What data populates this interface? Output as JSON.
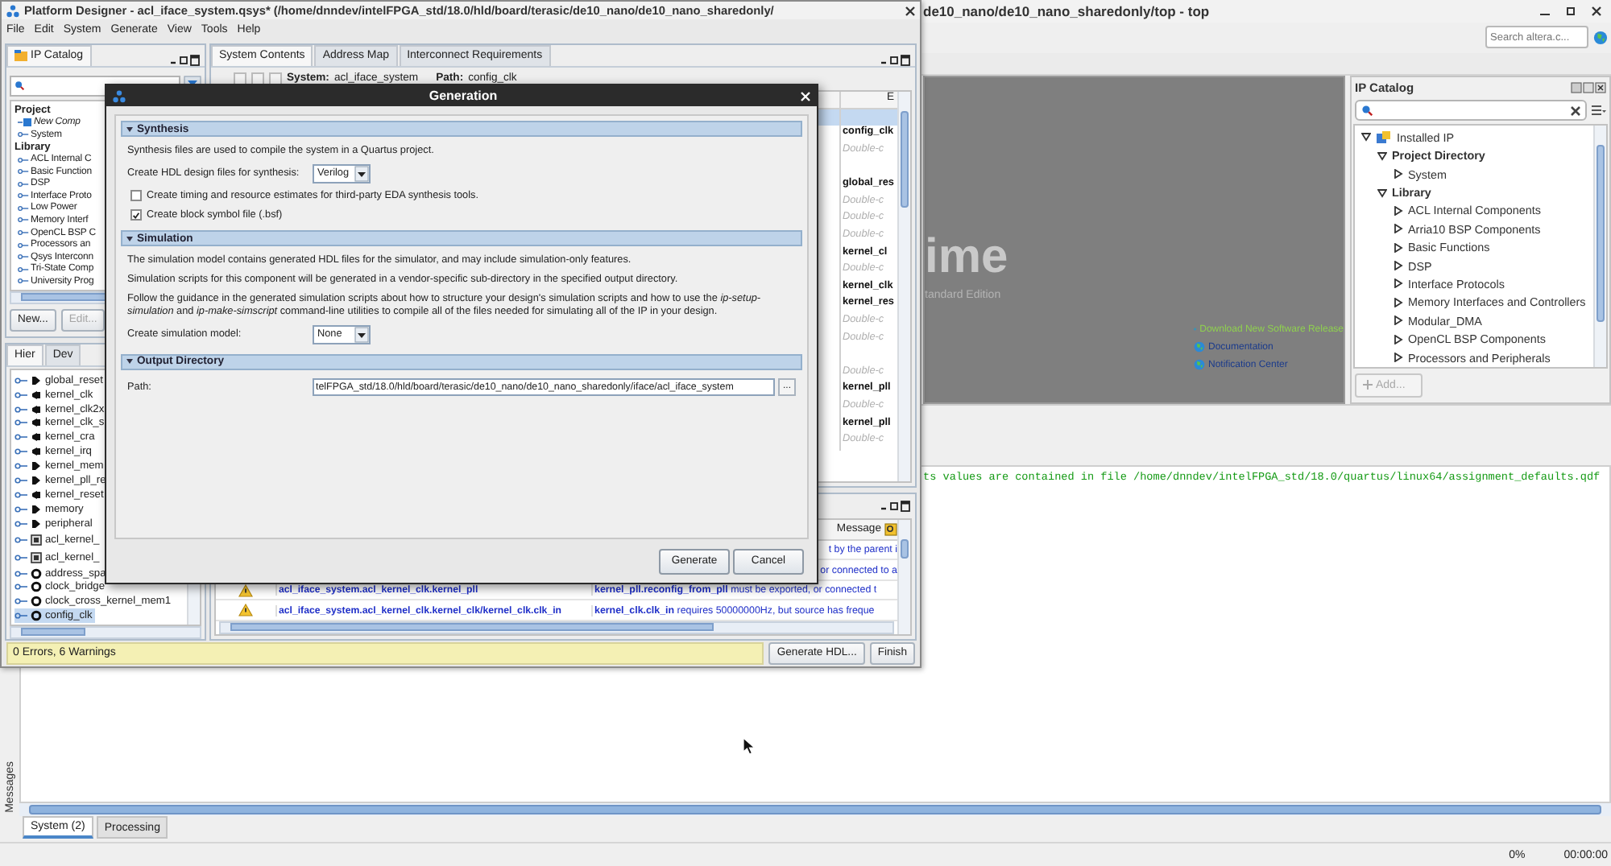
{
  "quartus": {
    "title": "de10_nano/de10_nano_sharedonly/top - top",
    "search": {
      "placeholder": "Search altera.c..."
    },
    "home": {
      "logo_text": "ime",
      "edition": "tandard Edition",
      "links": [
        {
          "label": "Download New Software Release",
          "kind": "highlight"
        },
        {
          "label": "Documentation",
          "kind": "normal"
        },
        {
          "label": "Notification Center",
          "kind": "normal"
        }
      ]
    },
    "ip_catalog": {
      "title": "IP Catalog",
      "tree": [
        {
          "label": "Installed IP",
          "kind": "root",
          "expanded": true,
          "children": [
            {
              "label": "Project Directory",
              "kind": "group",
              "expanded": true,
              "children": [
                {
                  "label": "System",
                  "kind": "item",
                  "expanded": false
                }
              ]
            },
            {
              "label": "Library",
              "kind": "group",
              "expanded": true,
              "children": [
                {
                  "label": "ACL Internal Components",
                  "kind": "item",
                  "expanded": false
                },
                {
                  "label": "Arria10 BSP Components",
                  "kind": "item",
                  "expanded": false
                },
                {
                  "label": "Basic Functions",
                  "kind": "item",
                  "expanded": false
                },
                {
                  "label": "DSP",
                  "kind": "item",
                  "expanded": false
                },
                {
                  "label": "Interface Protocols",
                  "kind": "item",
                  "expanded": false
                },
                {
                  "label": "Memory Interfaces and Controllers",
                  "kind": "item",
                  "expanded": false
                },
                {
                  "label": "Modular_DMA",
                  "kind": "item",
                  "expanded": false
                },
                {
                  "label": "OpenCL BSP Components",
                  "kind": "item",
                  "expanded": false
                },
                {
                  "label": "Processors and Peripherals",
                  "kind": "item",
                  "expanded": false
                }
              ]
            }
          ]
        }
      ],
      "add_button": {
        "label": "Add...",
        "disabled": true
      }
    },
    "messages": {
      "lines": [
        "ts values are contained in file /home/dnndev/intelFPGA_std/18.0/quartus/linux64/assignment_defaults.qdf"
      ],
      "side_tab": "Messages",
      "tabs": [
        {
          "label": "System (2)",
          "selected": true
        },
        {
          "label": "Processing",
          "selected": false
        }
      ]
    },
    "status": {
      "progress": "0%",
      "time": "00:00:00"
    }
  },
  "platform_designer": {
    "title": "Platform Designer - acl_iface_system.qsys* (/home/dnndev/intelFPGA_std/18.0/hld/board/terasic/de10_nano/de10_nano_sharedonly/",
    "menu": [
      "File",
      "Edit",
      "System",
      "Generate",
      "View",
      "Tools",
      "Help"
    ],
    "ip_catalog": {
      "tab": "IP Catalog",
      "sections": [
        {
          "label": "Project",
          "items": [
            {
              "label": "New Comp",
              "kind": "new"
            },
            {
              "label": "System",
              "kind": "item"
            }
          ]
        },
        {
          "label": "Library",
          "items": [
            {
              "label": "ACL Internal C",
              "kind": "item"
            },
            {
              "label": "Basic Function",
              "kind": "item"
            },
            {
              "label": "DSP",
              "kind": "item"
            },
            {
              "label": "Interface Proto",
              "kind": "item"
            },
            {
              "label": "Low Power",
              "kind": "item"
            },
            {
              "label": "Memory Interf",
              "kind": "item"
            },
            {
              "label": "OpenCL BSP C",
              "kind": "item"
            },
            {
              "label": "Processors an",
              "kind": "item"
            },
            {
              "label": "Qsys Interconn",
              "kind": "item"
            },
            {
              "label": "Tri-State Comp",
              "kind": "item"
            },
            {
              "label": "University Prog",
              "kind": "item"
            }
          ]
        }
      ],
      "buttons": [
        {
          "label": "New...",
          "disabled": false
        },
        {
          "label": "Edit...",
          "disabled": true
        }
      ]
    },
    "hierarchy": {
      "tabs": [
        {
          "label": "Hier",
          "selected": true
        },
        {
          "label": "Dev",
          "selected": false
        }
      ],
      "items": [
        {
          "label": "global_reset",
          "kind": "export_out",
          "selected": false
        },
        {
          "label": "kernel_clk",
          "kind": "export_in",
          "selected": false
        },
        {
          "label": "kernel_clk2x",
          "kind": "export_in",
          "selected": false
        },
        {
          "label": "kernel_clk_s",
          "kind": "export_in",
          "selected": false
        },
        {
          "label": "kernel_cra",
          "kind": "export_in",
          "selected": false
        },
        {
          "label": "kernel_irq",
          "kind": "export_in",
          "selected": false
        },
        {
          "label": "kernel_mem",
          "kind": "export_out",
          "selected": false
        },
        {
          "label": "kernel_pll_re",
          "kind": "export_out",
          "selected": false
        },
        {
          "label": "kernel_reset",
          "kind": "export_in",
          "selected": false
        },
        {
          "label": "memory",
          "kind": "export_out",
          "selected": false
        },
        {
          "label": "peripheral",
          "kind": "export_out",
          "selected": false
        },
        {
          "label": "acl_kernel_",
          "kind": "module",
          "selected": false
        },
        {
          "label": "acl_kernel_",
          "kind": "module",
          "selected": false
        },
        {
          "label": "address_spa",
          "kind": "instance",
          "selected": false
        },
        {
          "label": "clock_bridge",
          "kind": "instance",
          "selected": false
        },
        {
          "label": "clock_cross_kernel_mem1",
          "kind": "instance",
          "selected": false
        },
        {
          "label": "config_clk",
          "kind": "instance",
          "selected": true
        }
      ]
    },
    "system_contents": {
      "tabs": [
        {
          "label": "System Contents",
          "selected": true
        },
        {
          "label": "Address Map",
          "selected": false
        },
        {
          "label": "Interconnect Requirements",
          "selected": false
        }
      ],
      "system_label": "System:",
      "system": "acl_iface_system",
      "path_label": "Path:",
      "path": "config_clk",
      "column": "E",
      "rows": [
        {
          "selected": true
        },
        {
          "text": "config_clk",
          "kind": "name",
          "selected": false
        },
        {
          "text": "Double-c",
          "kind": "hint",
          "selected": false
        },
        {
          "selected": false
        },
        {
          "text": "global_res",
          "kind": "name",
          "selected": false
        },
        {
          "text": "Double-c",
          "kind": "hint",
          "selected": false
        },
        {
          "text": "Double-c",
          "kind": "hint",
          "selected": false
        },
        {
          "text": "Double-c",
          "kind": "hint",
          "selected": false
        },
        {
          "text": "kernel_cl",
          "kind": "name",
          "selected": false
        },
        {
          "text": "Double-c",
          "kind": "hint",
          "selected": false
        },
        {
          "text": "kernel_clk",
          "kind": "name",
          "selected": false
        },
        {
          "text": "kernel_res",
          "kind": "name",
          "selected": false
        },
        {
          "text": "Double-c",
          "kind": "hint",
          "selected": false
        },
        {
          "text": "Double-c",
          "kind": "hint",
          "selected": false
        },
        {
          "selected": false
        },
        {
          "text": "Double-c",
          "kind": "hint",
          "selected": false
        },
        {
          "text": "kernel_pll",
          "kind": "name",
          "selected": false
        },
        {
          "text": "Double-c",
          "kind": "hint",
          "selected": false
        },
        {
          "text": "kernel_pll",
          "kind": "name",
          "selected": false
        },
        {
          "text": "Double-c",
          "kind": "hint",
          "selected": false
        }
      ]
    },
    "messages": {
      "header": "Message",
      "rows": [
        {
          "message": "t by the parent i"
        },
        {
          "message": "or connected to a"
        },
        {
          "kind": "warning",
          "path": "acl_iface_system.acl_kernel_clk.kernel_pll",
          "source": "kernel_pll.reconfig_from_pll",
          "message": "must be exported, or connected t"
        },
        {
          "kind": "warning",
          "path": "acl_iface_system.acl_kernel_clk.kernel_clk/kernel_clk.clk_in",
          "source": "kernel_clk.clk_in",
          "message": "requires 50000000Hz, but source has freque"
        }
      ]
    },
    "status": "0 Errors, 6 Warnings",
    "buttons": [
      "Generate HDL...",
      "Finish"
    ]
  },
  "dialog": {
    "title": "Generation",
    "synthesis": {
      "title": "Synthesis",
      "expanded": true,
      "description": "Synthesis files are used to compile the system in a Quartus project.",
      "hdl_label": "Create HDL design files for synthesis:",
      "hdl_value": "Verilog",
      "options": [
        {
          "label": "Create timing and resource estimates for third-party EDA synthesis tools.",
          "checked": false
        },
        {
          "label": "Create block symbol file (.bsf)",
          "checked": true
        }
      ]
    },
    "simulation": {
      "title": "Simulation",
      "expanded": true,
      "paragraphs": [
        "The simulation model contains generated HDL files for the simulator, and may include simulation-only features.",
        "Simulation scripts for this component will be generated in a vendor-specific sub-directory in the specified output directory.",
        "Follow the guidance in the generated simulation scripts about how to structure your design's simulation scripts and how to use the *ip-setup-simulation* and *ip-make-simscript* command-line utilities to compile all of the files needed for simulating all of the IP in your design."
      ],
      "model_label": "Create simulation model:",
      "model_value": "None"
    },
    "output": {
      "title": "Output Directory",
      "expanded": true,
      "path_label": "Path:",
      "path": "telFPGA_std/18.0/hld/board/terasic/de10_nano/de10_nano_sharedonly/iface/acl_iface_system",
      "browse": "..."
    },
    "buttons": [
      "Generate",
      "Cancel"
    ]
  }
}
